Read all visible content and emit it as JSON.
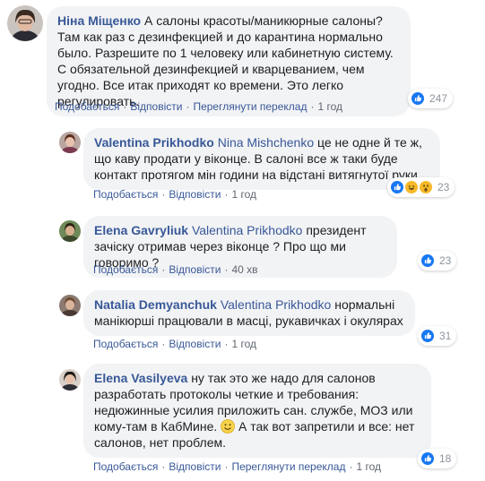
{
  "comments": [
    {
      "author": "Ніна Міщенко",
      "text": "А салоны красоты/маникюрные салоны? Там как раз с дезинфекцией и до карантина нормально было. Разрешите по 1 человеку или кабинетную систему. С обязательной дезинфекцией и кварцеванием, чем угодно. Все итак приходят ко времени. Это легко регулировать.",
      "reactions": "247",
      "actions": [
        "Подобається",
        "Відповісти",
        "Переглянути переклад"
      ],
      "time": "1 год"
    },
    {
      "author": "Valentina Prikhodko",
      "mention": "Nina Mishchenko",
      "text": "це не одне й те ж, що каву продати у віконце. В салоні все ж таки буде контакт протягом мін години на відстані витягнутої руки.",
      "reactions": "23",
      "actions": [
        "Подобається",
        "Відповісти"
      ],
      "time": "1 год"
    },
    {
      "author": "Elena Gavryliuk",
      "mention": "Valentina Prikhodko",
      "text": "президент зачіску отримав через віконце ? Про що ми говоримо ?",
      "reactions": "23",
      "actions": [
        "Подобається",
        "Відповісти"
      ],
      "time": "40 хв"
    },
    {
      "author": "Natalia Demyanchuk",
      "mention": "Valentina Prikhodko",
      "text": "нормальні манікюрші працювали в масці, рукавичках і окулярах",
      "reactions": "31",
      "actions": [
        "Подобається",
        "Відповісти"
      ],
      "time": "1 год"
    },
    {
      "author": "Elena Vasilyeva",
      "text1": "ну так это же надо для салонов разработать протоколы четкие и требования: недюжинные усилия приложить сан. службе, МОЗ или кому-там в КабМине.",
      "text2": "А так вот запретили и все: нет салонов, нет проблем.",
      "reactions": "18",
      "actions": [
        "Подобається",
        "Відповісти",
        "Переглянути переклад"
      ],
      "time": "1 год"
    }
  ],
  "separator": "·",
  "colors": {
    "link": "#385898",
    "bubble": "#f2f3f5",
    "like": "#1877f2",
    "haha": "#f7b928",
    "meta": "#606770"
  },
  "icons": [
    "like-icon",
    "haha-icon",
    "wow-icon",
    "smile-emoji-icon"
  ]
}
